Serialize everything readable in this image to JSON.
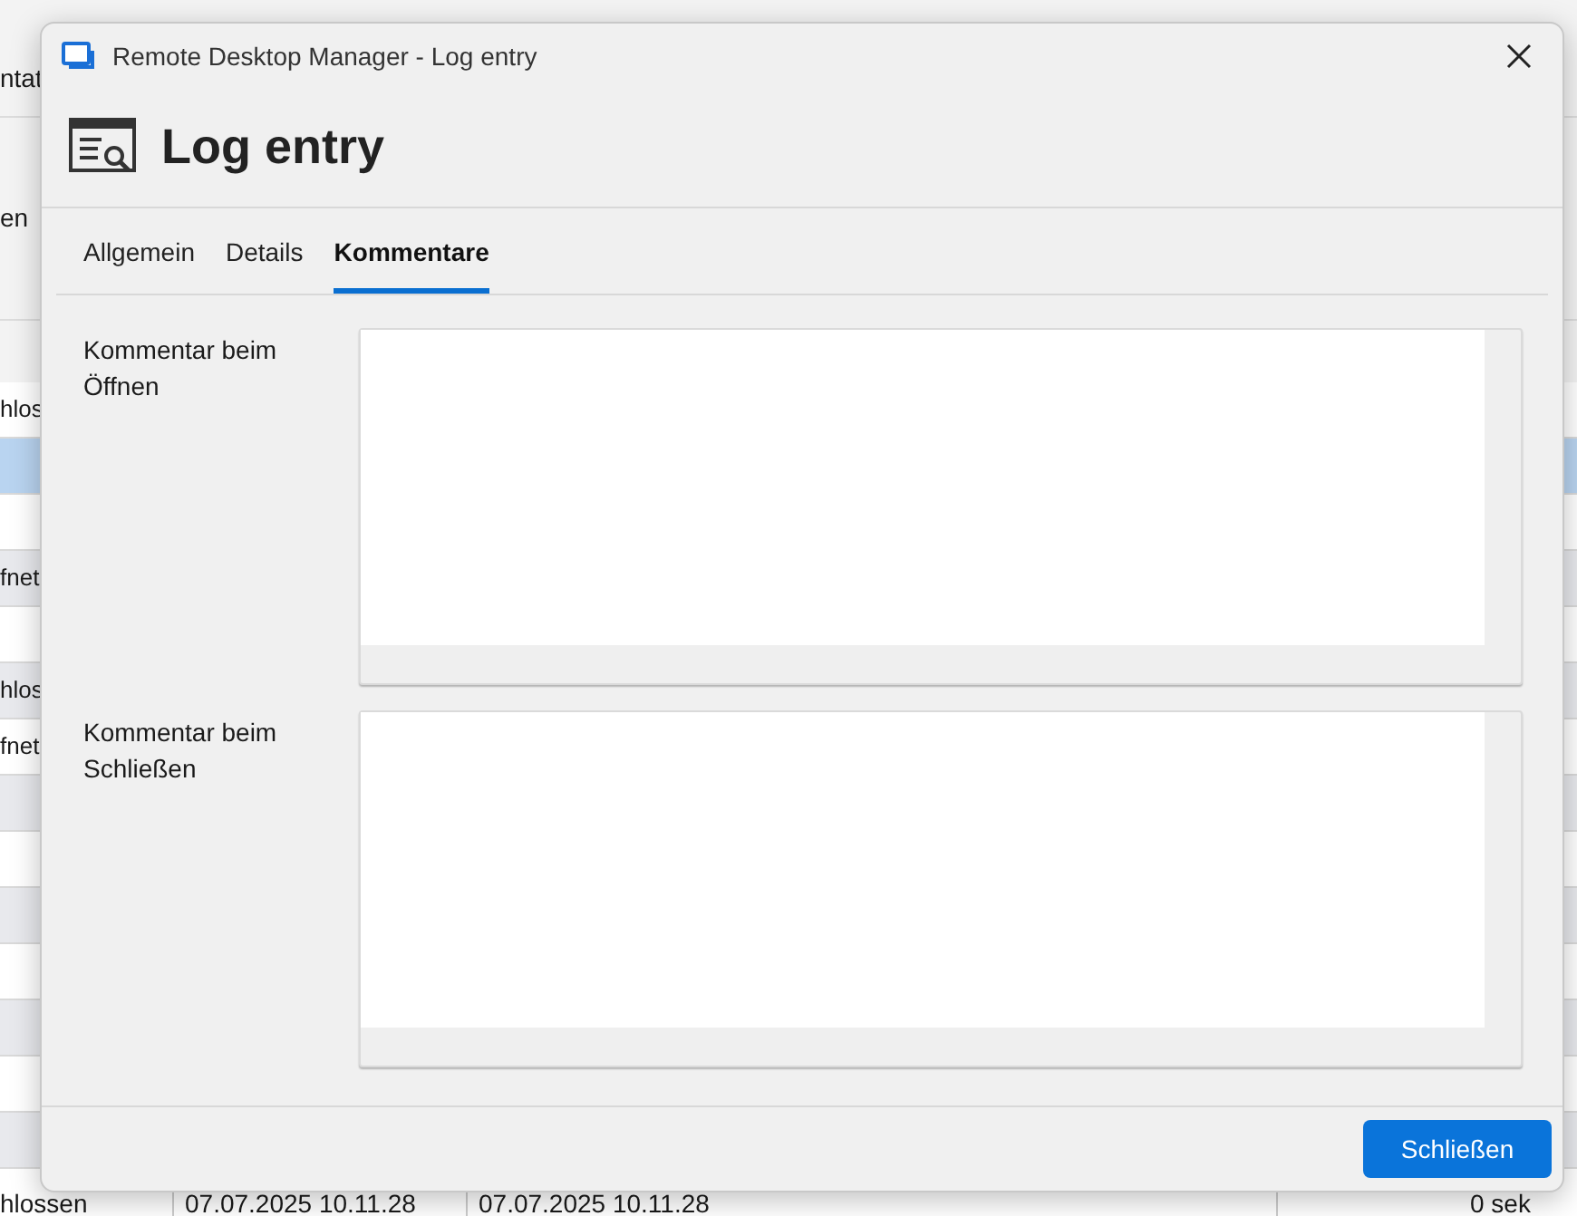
{
  "background": {
    "top_texts": [
      "ntat",
      "en"
    ],
    "rows": [
      {
        "text": "hlos",
        "selected": false
      },
      {
        "text": "",
        "selected": true
      },
      {
        "text": "",
        "selected": false
      },
      {
        "text": "fnet",
        "selected": false
      },
      {
        "text": "",
        "selected": false
      },
      {
        "text": "hlos",
        "selected": false
      },
      {
        "text": "fnet",
        "selected": false
      },
      {
        "text": "",
        "selected": false
      },
      {
        "text": "",
        "selected": false
      },
      {
        "text": "",
        "selected": false
      },
      {
        "text": "",
        "selected": false
      },
      {
        "text": "",
        "selected": false
      },
      {
        "text": "",
        "selected": false
      },
      {
        "text": "",
        "selected": false
      }
    ],
    "last_row": [
      "hlossen",
      "07.07.2025 10.11.28",
      "07.07.2025 10.11.28",
      "0 sek"
    ]
  },
  "window": {
    "title": "Remote Desktop Manager - Log entry"
  },
  "header": {
    "title": "Log entry"
  },
  "tabs": [
    {
      "label": "Allgemein",
      "selected": false
    },
    {
      "label": "Details",
      "selected": false
    },
    {
      "label": "Kommentare",
      "selected": true
    }
  ],
  "fields": [
    {
      "label": "Kommentar beim Öffnen"
    },
    {
      "label": "Kommentar beim Schließen"
    }
  ],
  "buttons": [
    "Schließen"
  ]
}
